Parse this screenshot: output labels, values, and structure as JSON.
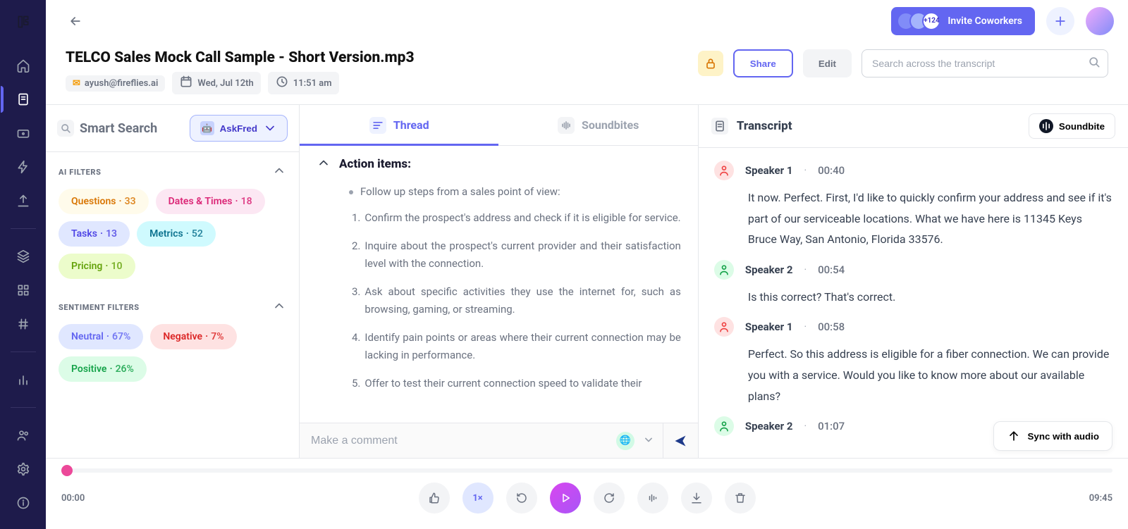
{
  "header": {
    "invite": {
      "label": "Invite Coworkers",
      "more_count": "+124"
    }
  },
  "title": {
    "text": "TELCO Sales Mock Call Sample - Short Version.mp3",
    "owner": "ayush@fireflies.ai",
    "date": "Wed, Jul 12th",
    "time": "11:51 am"
  },
  "actions": {
    "share": "Share",
    "edit": "Edit"
  },
  "search": {
    "placeholder": "Search across the transcript"
  },
  "smart_search": {
    "label": "Smart Search",
    "askfred": "AskFred"
  },
  "filters": {
    "ai_label": "AI FILTERS",
    "ai": [
      {
        "name": "Questions",
        "count": "33",
        "cls": "chip-questions"
      },
      {
        "name": "Dates & Times",
        "count": "18",
        "cls": "chip-dates"
      },
      {
        "name": "Tasks",
        "count": "13",
        "cls": "chip-tasks"
      },
      {
        "name": "Metrics",
        "count": "52",
        "cls": "chip-metrics"
      },
      {
        "name": "Pricing",
        "count": "10",
        "cls": "chip-pricing"
      }
    ],
    "sentiment_label": "SENTIMENT FILTERS",
    "sentiment": [
      {
        "name": "Neutral",
        "count": "67%",
        "cls": "chip-neutral"
      },
      {
        "name": "Negative",
        "count": "7%",
        "cls": "chip-negative"
      },
      {
        "name": "Positive",
        "count": "26%",
        "cls": "chip-positive"
      }
    ]
  },
  "tabs": {
    "thread": "Thread",
    "soundbites": "Soundbites"
  },
  "thread": {
    "section_title": "Action items:",
    "lead": "Follow up steps from a sales point of view:",
    "items": [
      "Confirm the prospect's address and check if it is eligible for service.",
      "Inquire about the prospect's current provider and their satisfaction level with the connection.",
      "Ask about specific activities they use the internet for, such as browsing, gaming, or streaming.",
      "Identify pain points or areas where their current connection may be lacking in performance.",
      "Offer to test their current connection speed to validate their"
    ]
  },
  "comment": {
    "placeholder": "Make a comment"
  },
  "transcript": {
    "label": "Transcript",
    "soundbite_btn": "Soundbite",
    "sync": "Sync with audio",
    "turns": [
      {
        "speaker": "Speaker 1",
        "spk": 1,
        "time": "00:40",
        "text": "It now. Perfect. First, I'd like to quickly confirm your address and see if it's part of our serviceable locations. What we have here is 11345 Keys Bruce Way, San Antonio, Florida 33576."
      },
      {
        "speaker": "Speaker 2",
        "spk": 2,
        "time": "00:54",
        "text": "Is this correct? That's correct."
      },
      {
        "speaker": "Speaker 1",
        "spk": 1,
        "time": "00:58",
        "text": "Perfect. So this address is eligible for a fiber connection. We can provide you with a service. Would you like to know more about our available plans?"
      },
      {
        "speaker": "Speaker 2",
        "spk": 2,
        "time": "01:07",
        "text": ""
      }
    ]
  },
  "player": {
    "current": "00:00",
    "total": "09:45",
    "speed": "1×"
  }
}
